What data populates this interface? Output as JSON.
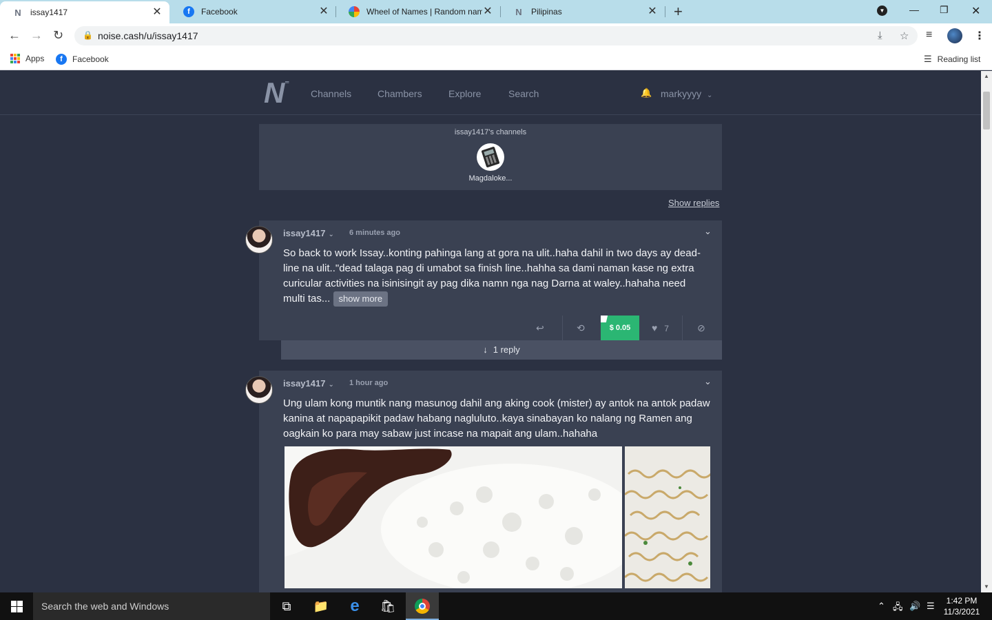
{
  "browser": {
    "tabs": [
      {
        "title": "issay1417",
        "favicon": "noise-icon",
        "active": true
      },
      {
        "title": "Facebook",
        "favicon": "facebook-icon",
        "active": false
      },
      {
        "title": "Wheel of Names | Random name",
        "favicon": "wheel-icon",
        "active": false
      },
      {
        "title": "Pilipinas",
        "favicon": "noise-icon",
        "active": false
      }
    ],
    "url": "noise.cash/u/issay1417",
    "bookmarks": {
      "apps_label": "Apps",
      "facebook_label": "Facebook",
      "reading_list_label": "Reading list"
    }
  },
  "site": {
    "nav": [
      "Channels",
      "Chambers",
      "Explore",
      "Search"
    ],
    "user": "markyyyy"
  },
  "channels": {
    "title": "issay1417's channels",
    "items": [
      {
        "name": "Magdaloke...",
        "icon": "calculator-icon"
      }
    ]
  },
  "show_replies_label": "Show replies",
  "posts": [
    {
      "author": "issay1417",
      "time": "6 minutes ago",
      "text": "So back to work Issay..konting pahinga lang at gora na ulit..haha dahil in two days ay dead-line na ulit..\"dead talaga pag di umabot sa finish line..hahha sa dami naman kase ng extra curicular activities na isinisingit ay pag dika namn nga nag Darna at waley..hahaha need multi tas...",
      "show_more_label": "show more",
      "tip_amount": "$ 0.05",
      "likes": "7",
      "reply_label": "1 reply"
    },
    {
      "author": "issay1417",
      "time": "1 hour ago",
      "text": "Ung ulam kong muntik nang masunog dahil ang aking cook (mister) ay antok na antok padaw kanina at napapapikit padaw habang nagluluto..kaya sinabayan ko nalang ng Ramen ang oagkain ko para may sabaw just incase na mapait ang ulam..hahaha"
    }
  ],
  "taskbar": {
    "search_placeholder": "Search the web and Windows",
    "time": "1:42 PM",
    "date": "11/3/2021"
  },
  "colors": {
    "page_bg": "#2b3142",
    "card_bg": "#3a4152",
    "tip_green": "#2bb673",
    "tabstrip": "#b8ddea"
  }
}
